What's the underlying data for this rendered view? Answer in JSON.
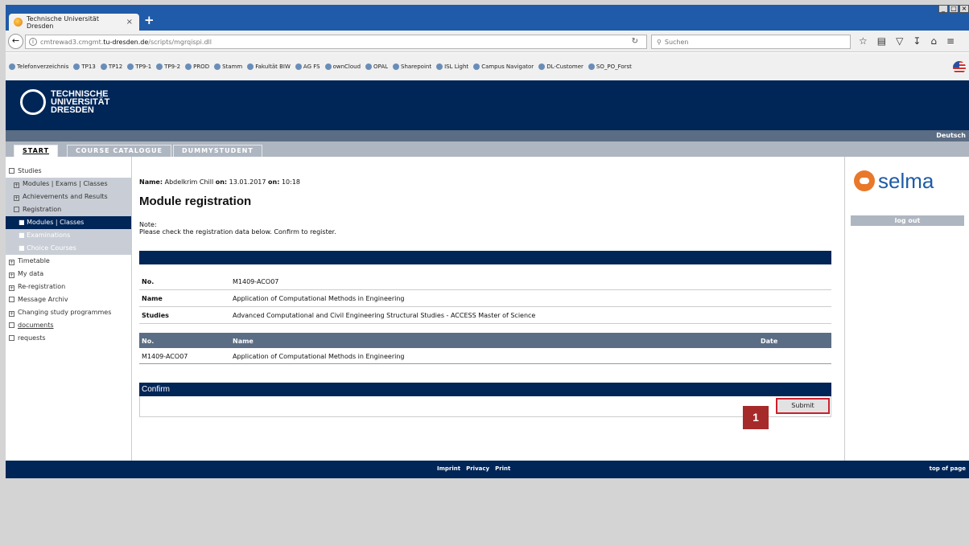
{
  "browser": {
    "tab_title": "Technische Universität Dresden",
    "tab_close": "×",
    "new_tab": "+",
    "url_prefix": "cmtrewad3.cmgmt.",
    "url_domain": "tu-dresden.de",
    "url_path": "/scripts/mgrqispi.dll",
    "search_placeholder": "Suchen",
    "bookmarks": [
      "Telefonverzeichnis",
      "TP13",
      "TP12",
      "TP9-1",
      "TP9-2",
      "PROD",
      "Stamm",
      "Fakultät BIW",
      "AG FS",
      "ownCloud",
      "OPAL",
      "Sharepoint",
      "ISL Light",
      "Campus Navigator",
      "DL-Customer",
      "SO_PO_Forst"
    ]
  },
  "header": {
    "logo_line1": "TECHNISCHE",
    "logo_line2": "UNIVERSITÄT",
    "logo_line3": "DRESDEN",
    "language": "Deutsch"
  },
  "menu": {
    "start": "START",
    "catalogue": "COURSE CATALOGUE",
    "dummy": "DUMMYSTUDENT"
  },
  "sidebar": {
    "studies": "Studies",
    "modules_exams": "Modules | Exams | Classes",
    "achievements": "Achievements and Results",
    "registration": "Registration",
    "modules_classes": "Modules | Classes",
    "examinations": "Examinations",
    "choice_courses": "Choice Courses",
    "timetable": "Timetable",
    "my_data": "My data",
    "reregistration": "Re-registration",
    "message_archiv": "Message Archiv",
    "changing": "Changing study programmes",
    "documents": "documents",
    "requests": "requests"
  },
  "main": {
    "name_label": "Name:",
    "name_value": "Abdelkrim Chill",
    "on_label": "on:",
    "date_value": "13.01.2017",
    "on_label2": "on:",
    "time_value": "10:18",
    "title": "Module registration",
    "note_label": "Note:",
    "note_text": "Please check the registration data below. Confirm to register.",
    "details": [
      {
        "key": "No.",
        "value": "M1409-ACO07"
      },
      {
        "key": "Name",
        "value": "Application of Computational Methods in Engineering"
      },
      {
        "key": "Studies",
        "value": "Advanced Computational and Civil Engineering Structural Studies - ACCESS Master of Science"
      }
    ],
    "table_headers": {
      "no": "No.",
      "name": "Name",
      "date": "Date"
    },
    "table_row": {
      "no": "M1409-ACO07",
      "name": "Application of Computational Methods in Engineering",
      "date": ""
    },
    "confirm": "Confirm",
    "submit": "Submit",
    "callout": "1"
  },
  "right": {
    "brand": "selma",
    "logout": "log out"
  },
  "footer": {
    "imprint": "Imprint",
    "privacy": "Privacy",
    "print": "Print",
    "top": "top of page"
  }
}
